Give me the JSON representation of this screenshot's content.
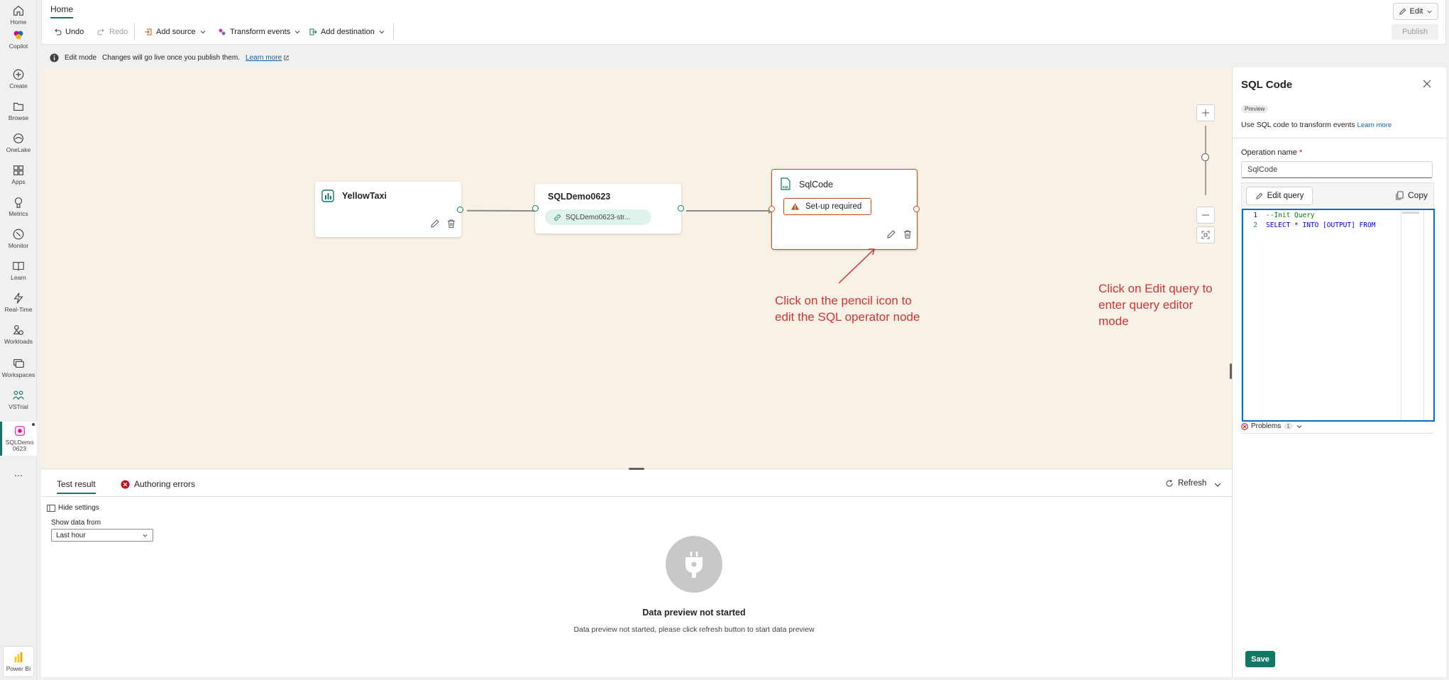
{
  "rail": {
    "items": [
      {
        "label": "Home",
        "icon": "home-icon"
      },
      {
        "label": "Copilot",
        "icon": "copilot-icon"
      },
      {
        "label": "Create",
        "icon": "create-icon"
      },
      {
        "label": "Browse",
        "icon": "browse-icon"
      },
      {
        "label": "OneLake",
        "icon": "onelake-icon"
      },
      {
        "label": "Apps",
        "icon": "apps-icon"
      },
      {
        "label": "Metrics",
        "icon": "metrics-icon"
      },
      {
        "label": "Monitor",
        "icon": "monitor-icon"
      },
      {
        "label": "Learn",
        "icon": "learn-icon"
      },
      {
        "label": "Real-Time",
        "icon": "realtime-icon"
      },
      {
        "label": "Workloads",
        "icon": "workloads-icon"
      },
      {
        "label": "Workspaces",
        "icon": "workspaces-icon"
      },
      {
        "label": "VSTrial",
        "icon": "vstrial-icon"
      }
    ],
    "active_item": "SQLDemo0623",
    "more": "...",
    "footer_label": "Power BI"
  },
  "ribbon": {
    "tab": "Home",
    "undo": "Undo",
    "redo": "Redo",
    "add_source": "Add source",
    "transform_events": "Transform events",
    "add_destination": "Add destination",
    "edit": "Edit",
    "publish": "Publish"
  },
  "infobar": {
    "mode": "Edit mode",
    "message": "Changes will go live once you publish them.",
    "link": "Learn more"
  },
  "canvas": {
    "source_node": "YellowTaxi",
    "stream_node": "SQLDemo0623",
    "stream_pill": "SQLDemo0623-str...",
    "sql_node": "SqlCode",
    "setup_warning": "Set-up required",
    "annotation_pencil": [
      "Click on the pencil icon to",
      "edit the SQL operator node"
    ],
    "annotation_edit": [
      "Click on Edit query to",
      "enter query editor",
      "mode"
    ]
  },
  "bottom": {
    "tab_test": "Test result",
    "tab_errors": "Authoring errors",
    "refresh": "Refresh",
    "hide_settings": "Hide settings",
    "show_data_label": "Show data from",
    "show_data_value": "Last hour",
    "empty_title": "Data preview not started",
    "empty_desc": "Data preview not started, please click refresh button to start data preview"
  },
  "pane": {
    "title": "SQL Code",
    "badge": "Preview",
    "desc": "Use SQL code to transform events",
    "learn_more": "Learn more",
    "op_label": "Operation name",
    "op_required": "*",
    "op_value": "SqlCode",
    "edit_query": "Edit query",
    "copy": "Copy",
    "code_lines": [
      {
        "n": "1",
        "text": "--Init Query"
      },
      {
        "n": "2",
        "text": "SELECT * INTO [OUTPUT] FROM"
      }
    ],
    "problems": "Problems",
    "problems_count": "1",
    "save": "Save"
  },
  "colors": {
    "accent": "#117865",
    "annotation": "#d13438",
    "warning": "#c4511b",
    "canvas_bg": "#f8f1e6"
  }
}
